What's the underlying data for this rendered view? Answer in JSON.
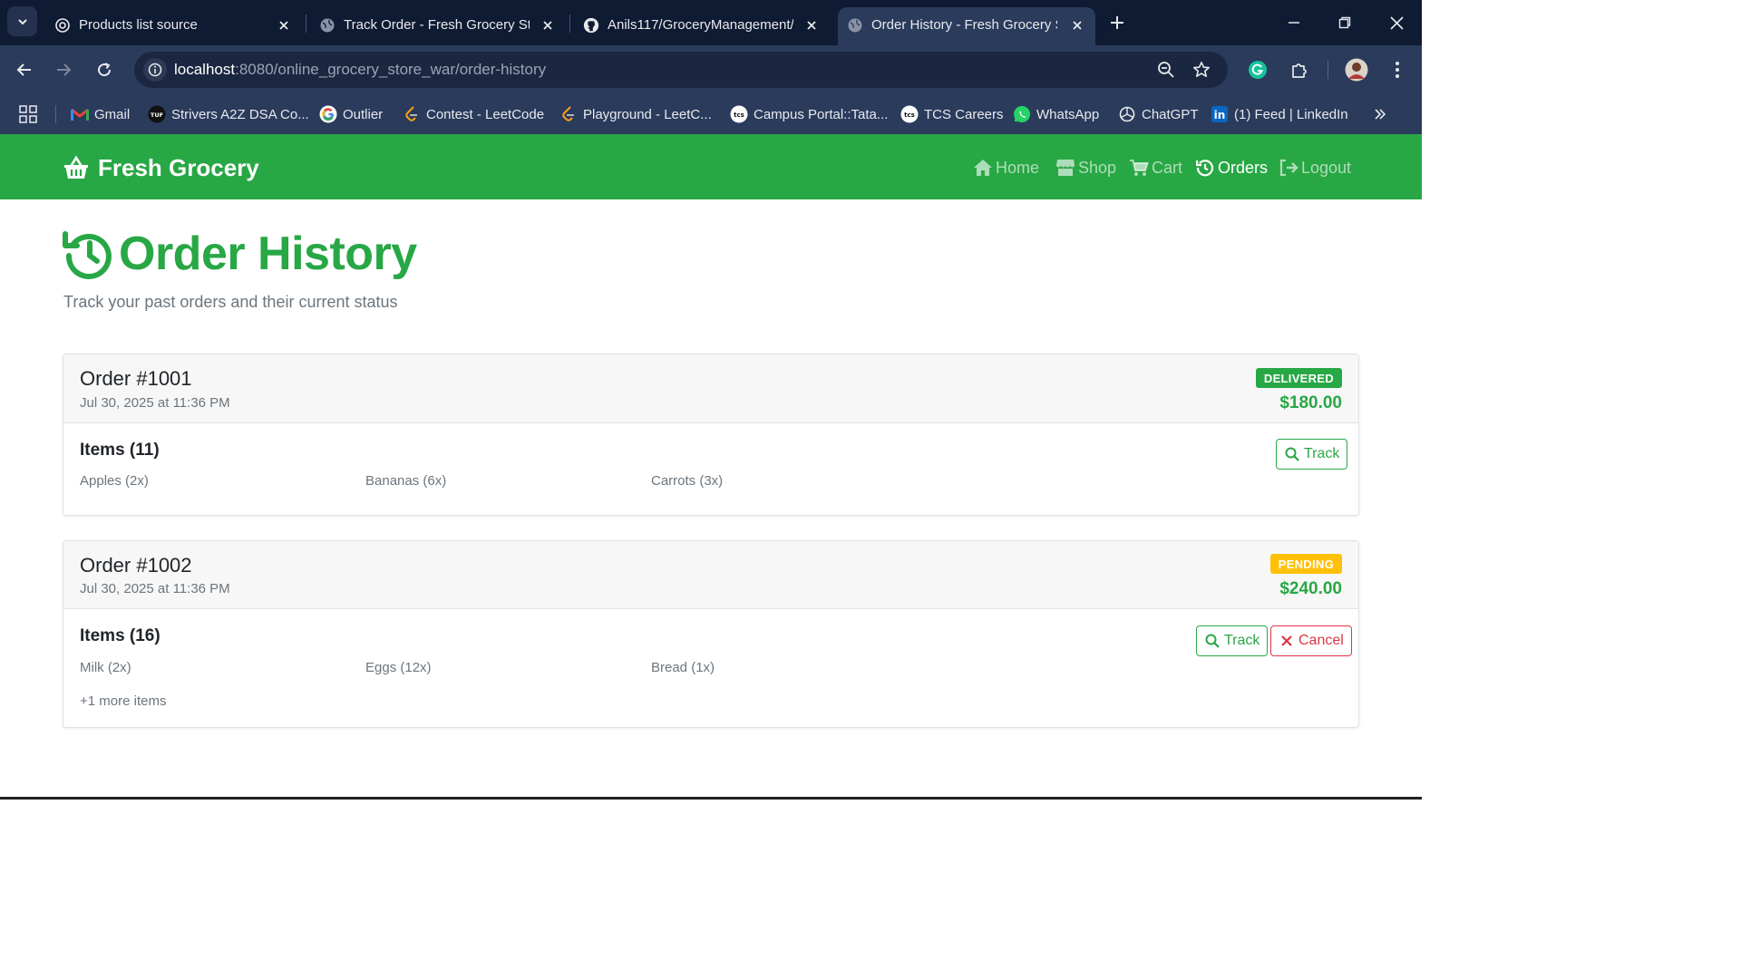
{
  "browser": {
    "tabs": [
      {
        "title": "Products list source",
        "active": false
      },
      {
        "title": "Track Order - Fresh Grocery Sto",
        "active": false
      },
      {
        "title": "Anils117/GroceryManagement/",
        "active": false
      },
      {
        "title": "Order History - Fresh Grocery S",
        "active": true
      }
    ],
    "address": {
      "host": "localhost",
      "path": ":8080/online_grocery_store_war/order-history"
    },
    "bookmarks": [
      {
        "label": "Gmail",
        "icon": "gmail-icon"
      },
      {
        "label": "Strivers A2Z DSA Co...",
        "icon": "tuf-icon"
      },
      {
        "label": "Outlier",
        "icon": "google-icon"
      },
      {
        "label": "Contest - LeetCode",
        "icon": "leetcode-icon"
      },
      {
        "label": "Playground - LeetC...",
        "icon": "leetcode-icon"
      },
      {
        "label": "Campus Portal::Tata...",
        "icon": "tcs-icon"
      },
      {
        "label": "TCS Careers",
        "icon": "tcs-icon"
      },
      {
        "label": "WhatsApp",
        "icon": "whatsapp-icon"
      },
      {
        "label": "ChatGPT",
        "icon": "chatgpt-icon"
      },
      {
        "label": "(1) Feed | LinkedIn",
        "icon": "linkedin-icon"
      }
    ]
  },
  "site": {
    "brand": "Fresh Grocery",
    "nav": [
      {
        "label": "Home",
        "icon": "home-icon",
        "active": false
      },
      {
        "label": "Shop",
        "icon": "store-icon",
        "active": false
      },
      {
        "label": "Cart",
        "icon": "cart-icon",
        "active": false
      },
      {
        "label": "Orders",
        "icon": "history-icon",
        "active": true
      },
      {
        "label": "Logout",
        "icon": "logout-icon",
        "active": false
      }
    ]
  },
  "page": {
    "title": "Order History",
    "subtitle": "Track your past orders and their current status"
  },
  "orders": [
    {
      "id": "Order #1001",
      "date": "Jul 30, 2025 at 11:36 PM",
      "status": "DELIVERED",
      "total": "$180.00",
      "items_title": "Items (11)",
      "items": [
        "Apples (2x)",
        "Bananas (6x)",
        "Carrots (3x)"
      ],
      "more": "",
      "track_label": "Track",
      "cancel_label": ""
    },
    {
      "id": "Order #1002",
      "date": "Jul 30, 2025 at 11:36 PM",
      "status": "PENDING",
      "total": "$240.00",
      "items_title": "Items (16)",
      "items": [
        "Milk (2x)",
        "Eggs (12x)",
        "Bread (1x)"
      ],
      "more": "+1 more items",
      "track_label": "Track",
      "cancel_label": "Cancel"
    }
  ],
  "colors": {
    "brand": "#28a745",
    "delivered": "#28a745",
    "pending": "#ffc107",
    "danger": "#dc3545"
  }
}
